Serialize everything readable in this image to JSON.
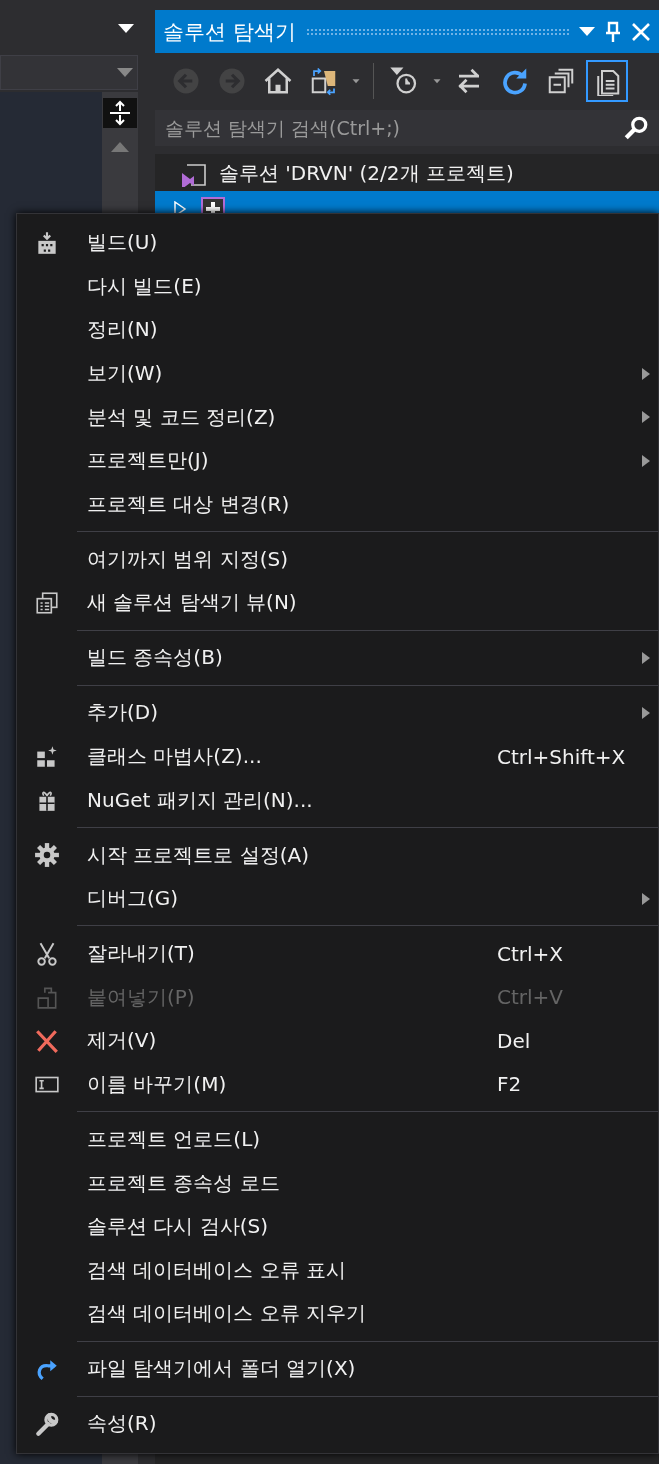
{
  "solution_explorer": {
    "title": "솔루션 탐색기",
    "toolbar": [
      {
        "disabled": true,
        "on": false
      },
      {
        "disabled": true,
        "on": false
      },
      {
        "disabled": false,
        "on": false
      },
      {
        "disabled": false,
        "on": false
      },
      {
        "disabled": false,
        "on": false
      },
      {
        "disabled": false,
        "on": false
      },
      {
        "disabled": false,
        "on": false
      },
      {
        "disabled": false,
        "on": false
      },
      {
        "disabled": false,
        "on": true
      }
    ],
    "search": {
      "placeholder": "솔루션 탐색기 검색(Ctrl+;)"
    },
    "tree": [
      {
        "label": "솔루션 'DRVN' (2/2개 프로젝트)",
        "selected": false,
        "children": [
          {
            "selected": true,
            "expanded": false
          }
        ]
      }
    ]
  },
  "context_menu": {
    "groups": [
      [
        {
          "label": "빌드(U)",
          "submenu": false,
          "disabled": false
        },
        {
          "label": "다시 빌드(E)",
          "submenu": false,
          "disabled": false
        },
        {
          "label": "정리(N)",
          "submenu": false,
          "disabled": false
        },
        {
          "label": "보기(W)",
          "submenu": true,
          "disabled": false
        },
        {
          "label": "분석 및 코드 정리(Z)",
          "submenu": true,
          "disabled": false
        },
        {
          "label": "프로젝트만(J)",
          "submenu": true,
          "disabled": false
        },
        {
          "label": "프로젝트 대상 변경(R)",
          "submenu": false,
          "disabled": false
        }
      ],
      [
        {
          "label": "여기까지 범위 지정(S)",
          "submenu": false,
          "disabled": false
        },
        {
          "label": "새 솔루션 탐색기 뷰(N)",
          "submenu": false,
          "disabled": false
        }
      ],
      [
        {
          "label": "빌드 종속성(B)",
          "submenu": true,
          "disabled": false
        }
      ],
      [
        {
          "label": "추가(D)",
          "submenu": true,
          "disabled": false
        },
        {
          "label": "클래스 마법사(Z)...",
          "shortcut": "Ctrl+Shift+X",
          "submenu": false,
          "disabled": false
        },
        {
          "label": "NuGet 패키지 관리(N)...",
          "submenu": false,
          "disabled": false
        }
      ],
      [
        {
          "label": "시작 프로젝트로 설정(A)",
          "submenu": false,
          "disabled": false
        },
        {
          "label": "디버그(G)",
          "submenu": true,
          "disabled": false
        }
      ],
      [
        {
          "label": "잘라내기(T)",
          "shortcut": "Ctrl+X",
          "submenu": false,
          "disabled": false
        },
        {
          "label": "붙여넣기(P)",
          "shortcut": "Ctrl+V",
          "submenu": false,
          "disabled": true
        },
        {
          "label": "제거(V)",
          "shortcut": "Del",
          "submenu": false,
          "disabled": false
        },
        {
          "label": "이름 바꾸기(M)",
          "shortcut": "F2",
          "submenu": false,
          "disabled": false
        }
      ],
      [
        {
          "label": "프로젝트 언로드(L)",
          "submenu": false,
          "disabled": false
        },
        {
          "label": "프로젝트 종속성 로드",
          "submenu": false,
          "disabled": false
        },
        {
          "label": "솔루션 다시 검사(S)",
          "submenu": false,
          "disabled": false
        },
        {
          "label": "검색 데이터베이스 오류 표시",
          "submenu": false,
          "disabled": false
        },
        {
          "label": "검색 데이터베이스 오류 지우기",
          "submenu": false,
          "disabled": false
        }
      ],
      [
        {
          "label": "파일 탐색기에서 폴더 열기(X)",
          "submenu": false,
          "disabled": false
        }
      ],
      [
        {
          "label": "속성(R)",
          "submenu": false,
          "disabled": false
        }
      ]
    ]
  }
}
